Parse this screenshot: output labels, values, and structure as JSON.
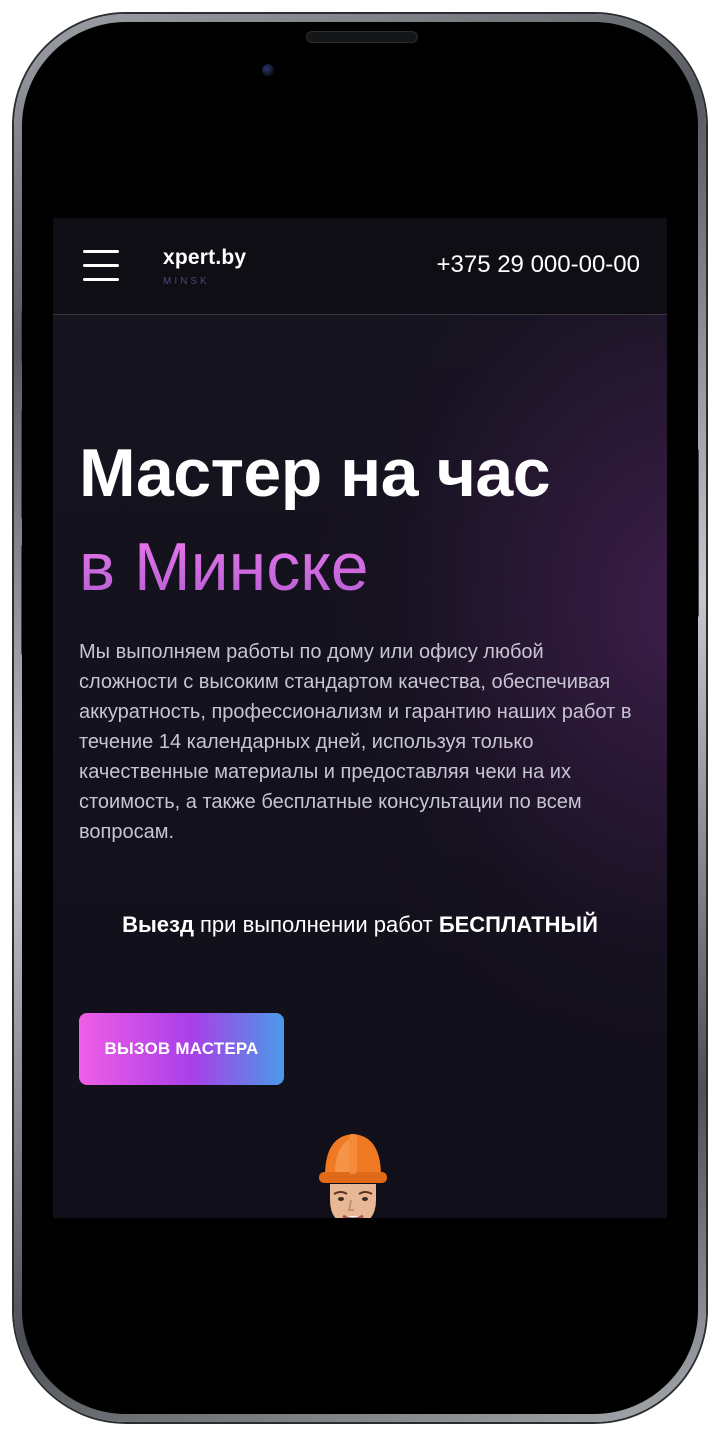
{
  "header": {
    "logo_name": "xpert.by",
    "logo_city": "MINSK",
    "phone": "+375 29 000-00-00"
  },
  "hero": {
    "title": "Мастер на час",
    "subtitle": "в Минске",
    "description": "Мы выполняем работы по дому или офису любой сложности с высоким стандартом качества, обеспечивая аккуратность, профессионализм и гарантию наших работ в течение 14 календарных дней, используя только качественные материалы и предоставляя чеки на их стоимость, а также бесплатные консультации по всем вопросам.",
    "visit_bold": "Выезд",
    "visit_middle": " при выполнении работ ",
    "visit_free": "БЕСПЛАТНЫЙ",
    "cta_label": "ВЫЗОВ МАСТЕРА"
  },
  "colors": {
    "background": "#110f19",
    "accent_pink": "#f05ee6",
    "accent_purple": "#a93fe8",
    "accent_blue": "#4a9ae8",
    "subtitle": "#d26ae6",
    "helmet": "#f07a24"
  },
  "icons": {
    "menu": "hamburger-icon",
    "master": "worker-in-hard-hat"
  }
}
